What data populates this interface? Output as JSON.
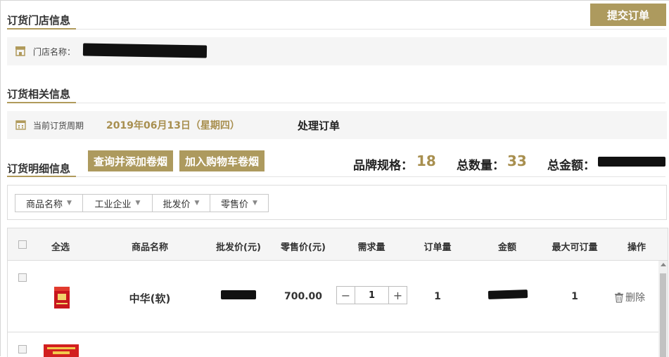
{
  "actions": {
    "submit_order": "提交订单"
  },
  "store_section": {
    "title": "订货门店信息",
    "store_name_label": "门店名称："
  },
  "order_info": {
    "title": "订货相关信息",
    "cycle_label": "当前订货周期",
    "cycle_value": "2019年06月13日（星期四）",
    "process_label": "处理订单"
  },
  "details": {
    "title": "订货明细信息",
    "query_add_button": "查询并添加卷烟",
    "add_cart_button": "加入购物车卷烟",
    "brand_spec_label": "品牌规格：",
    "brand_spec_value": "18",
    "total_qty_label": "总数量：",
    "total_qty_value": "33",
    "total_amount_label": "总金额："
  },
  "sort_bar": {
    "items": [
      "商品名称",
      "工业企业",
      "批发价",
      "零售价"
    ]
  },
  "table": {
    "headers": [
      "全选",
      "商品名称",
      "批发价(元)",
      "零售价(元)",
      "需求量",
      "订单量",
      "金额",
      "最大可订量",
      "操作"
    ],
    "rows": [
      {
        "name": "中华(软)",
        "retail_price": "700.00",
        "demand": "1",
        "order_qty": "1",
        "max_qty": "1",
        "delete_label": "删除"
      }
    ]
  },
  "stepper": {
    "minus": "−",
    "plus": "+"
  },
  "colors": {
    "accent": "#ad9a5e",
    "accent_text": "#a88f4f",
    "band": "#f5f5f5"
  }
}
